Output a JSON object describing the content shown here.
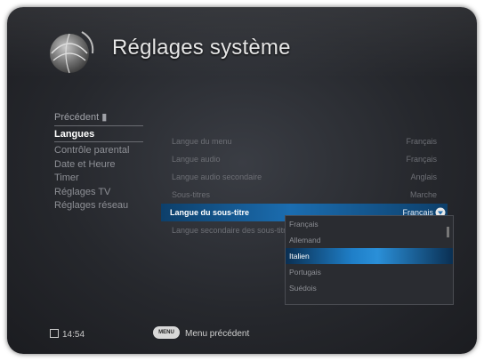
{
  "header": {
    "title": "Réglages système"
  },
  "left_menu": {
    "previous": "Précédent",
    "items": [
      "Langues",
      "Contrôle parental",
      "Date et Heure",
      "Timer",
      "Réglages TV",
      "Réglages réseau"
    ],
    "active_index": 0
  },
  "settings": {
    "rows": [
      {
        "label": "Langue du menu",
        "value": "Français"
      },
      {
        "label": "Langue audio",
        "value": "Français"
      },
      {
        "label": "Langue audio secondaire",
        "value": "Anglais"
      },
      {
        "label": "Sous-titres",
        "value": "Marche"
      },
      {
        "label": "Langue du sous-titre",
        "value": "Français"
      },
      {
        "label": "Langue secondaire des sous-titres",
        "value": ""
      }
    ],
    "highlight_index": 4
  },
  "dropdown": {
    "options": [
      "Français",
      "Allemand",
      "Italien",
      "Portugais",
      "Suédois"
    ],
    "selected_index": 2
  },
  "footer": {
    "time": "14:54",
    "menu_button": "MENU",
    "menu_label": "Menu précédent"
  },
  "colors": {
    "accent": "#1b6db0",
    "background": "#26282d"
  }
}
